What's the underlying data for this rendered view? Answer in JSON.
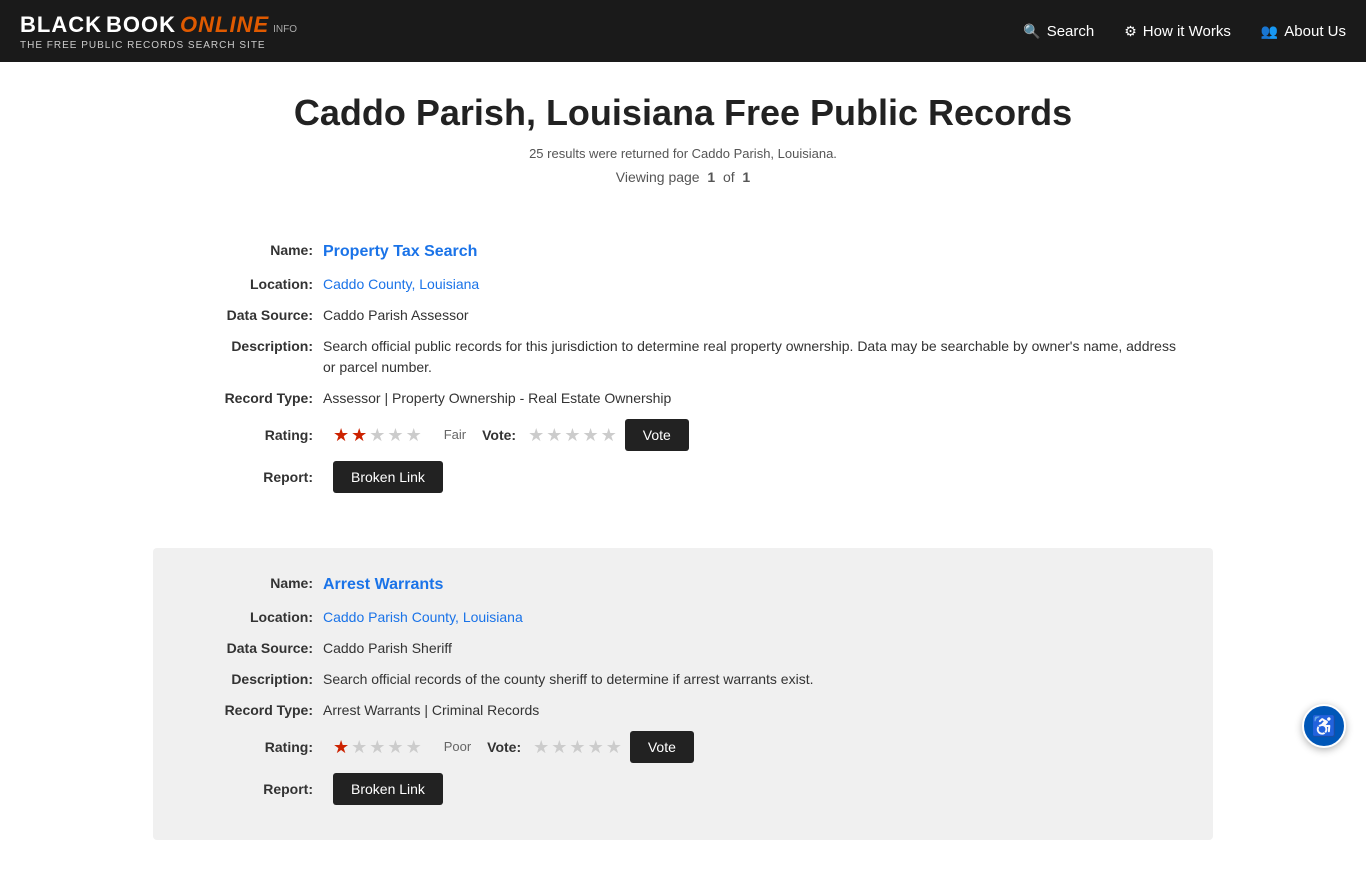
{
  "header": {
    "logo": {
      "black": "BLACK",
      "book": "BOOK",
      "online": "ONLINE",
      "info": "INFO",
      "subtitle": "THE FREE PUBLIC RECORDS SEARCH SITE"
    },
    "nav": [
      {
        "id": "search",
        "label": "Search",
        "icon": "🔍"
      },
      {
        "id": "how-it-works",
        "label": "How it Works",
        "icon": "⚙"
      },
      {
        "id": "about-us",
        "label": "About Us",
        "icon": "👥"
      }
    ]
  },
  "main": {
    "title": "Caddo Parish, Louisiana Free Public Records",
    "results_info": "25 results were returned for Caddo Parish, Louisiana.",
    "pagination": {
      "prefix": "Viewing page",
      "current": "1",
      "separator": "of",
      "total": "1"
    },
    "records": [
      {
        "id": "record-1",
        "shaded": false,
        "name": "Property Tax Search",
        "location": "Caddo County, Louisiana",
        "data_source": "Caddo Parish Assessor",
        "description": "Search official public records for this jurisdiction to determine real property ownership. Data may be searchable by owner's name, address or parcel number.",
        "record_type": "Assessor | Property Ownership - Real Estate Ownership",
        "rating_stars": 2,
        "rating_max": 5,
        "rating_label": "Fair",
        "vote_stars": 0,
        "vote_max": 5,
        "vote_button": "Vote",
        "report_button": "Broken Link"
      },
      {
        "id": "record-2",
        "shaded": true,
        "name": "Arrest Warrants",
        "location": "Caddo Parish County, Louisiana",
        "data_source": "Caddo Parish Sheriff",
        "description": "Search official records of the county sheriff to determine if arrest warrants exist.",
        "record_type": "Arrest Warrants | Criminal Records",
        "rating_stars": 1,
        "rating_max": 5,
        "rating_label": "Poor",
        "vote_stars": 0,
        "vote_max": 5,
        "vote_button": "Vote",
        "report_button": "Broken Link"
      }
    ]
  },
  "accessibility": {
    "icon": "♿",
    "label": "Accessibility"
  }
}
